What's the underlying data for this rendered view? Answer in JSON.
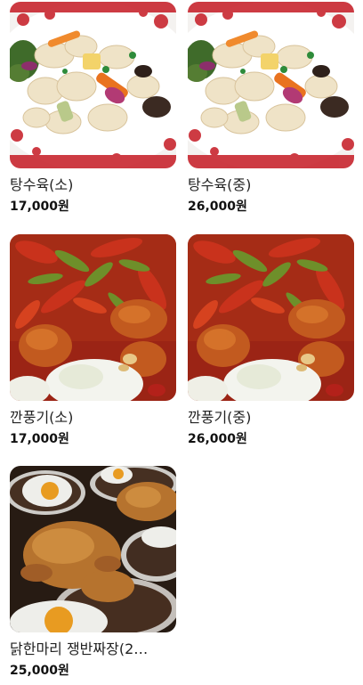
{
  "menu": {
    "items": [
      {
        "name": "탕수육(소)",
        "price": "17,000원",
        "image": "sweet-sour-pork"
      },
      {
        "name": "탕수육(중)",
        "price": "26,000원",
        "image": "sweet-sour-pork"
      },
      {
        "name": "깐풍기(소)",
        "price": "17,000원",
        "image": "kkanpunggi"
      },
      {
        "name": "깐풍기(중)",
        "price": "26,000원",
        "image": "kkanpunggi"
      },
      {
        "name": "닭한마리 쟁반짜장(2…",
        "price": "25,000원",
        "image": "fried-chicken-jjajang"
      }
    ]
  }
}
